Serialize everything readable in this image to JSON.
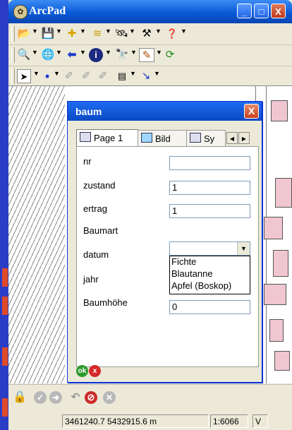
{
  "app": {
    "title": "ArcPad",
    "window_buttons": [
      "_",
      "□",
      "X"
    ]
  },
  "toolbars": {
    "row1": [
      "open-folder-icon",
      "save-icon",
      "add-layer-icon",
      "layers-icon",
      "gps-icon",
      "tools-icon",
      "help-icon"
    ],
    "row2": [
      "zoom-in-icon",
      "globe-icon",
      "back-arrow-icon",
      "info-icon",
      "find-icon",
      "edit-icon",
      "refresh-icon"
    ],
    "row3": [
      "pointer-icon",
      "point-icon",
      "line-icon",
      "polygon-icon",
      "table-icon",
      "edit-vertex-icon"
    ]
  },
  "dialog": {
    "title": "baum",
    "close_label": "X",
    "tabs": [
      {
        "label": "Page 1",
        "active": true
      },
      {
        "label": "Bild",
        "active": false
      },
      {
        "label": "Sy",
        "active": false
      }
    ],
    "fields": [
      {
        "label": "nr",
        "value": ""
      },
      {
        "label": "zustand",
        "value": "1"
      },
      {
        "label": "ertrag",
        "value": "1"
      },
      {
        "label": "Baumart",
        "value": "",
        "type": "select"
      },
      {
        "label": "datum",
        "value": ""
      },
      {
        "label": "jahr",
        "value": ""
      },
      {
        "label": "Baumhöhe",
        "value": "0"
      }
    ],
    "dropdown_options": [
      "Fichte",
      "Blautanne",
      "Apfel (Boskop)"
    ],
    "ok_label": "ok",
    "cancel_label": "x"
  },
  "bottom_toolbar": [
    "lock-icon",
    "check-icon",
    "forward-icon",
    "undo-icon",
    "no-entry-icon",
    "cancel-icon"
  ],
  "status": {
    "coordinates": "3461240.7 5432915.6 m",
    "scale": "1:6066",
    "extra": "V"
  },
  "colors": {
    "titlebar": "#0a5ad6",
    "parcel": "#f0c6d0",
    "ok": "#2e9a2e",
    "cancel": "#d42a2a"
  }
}
